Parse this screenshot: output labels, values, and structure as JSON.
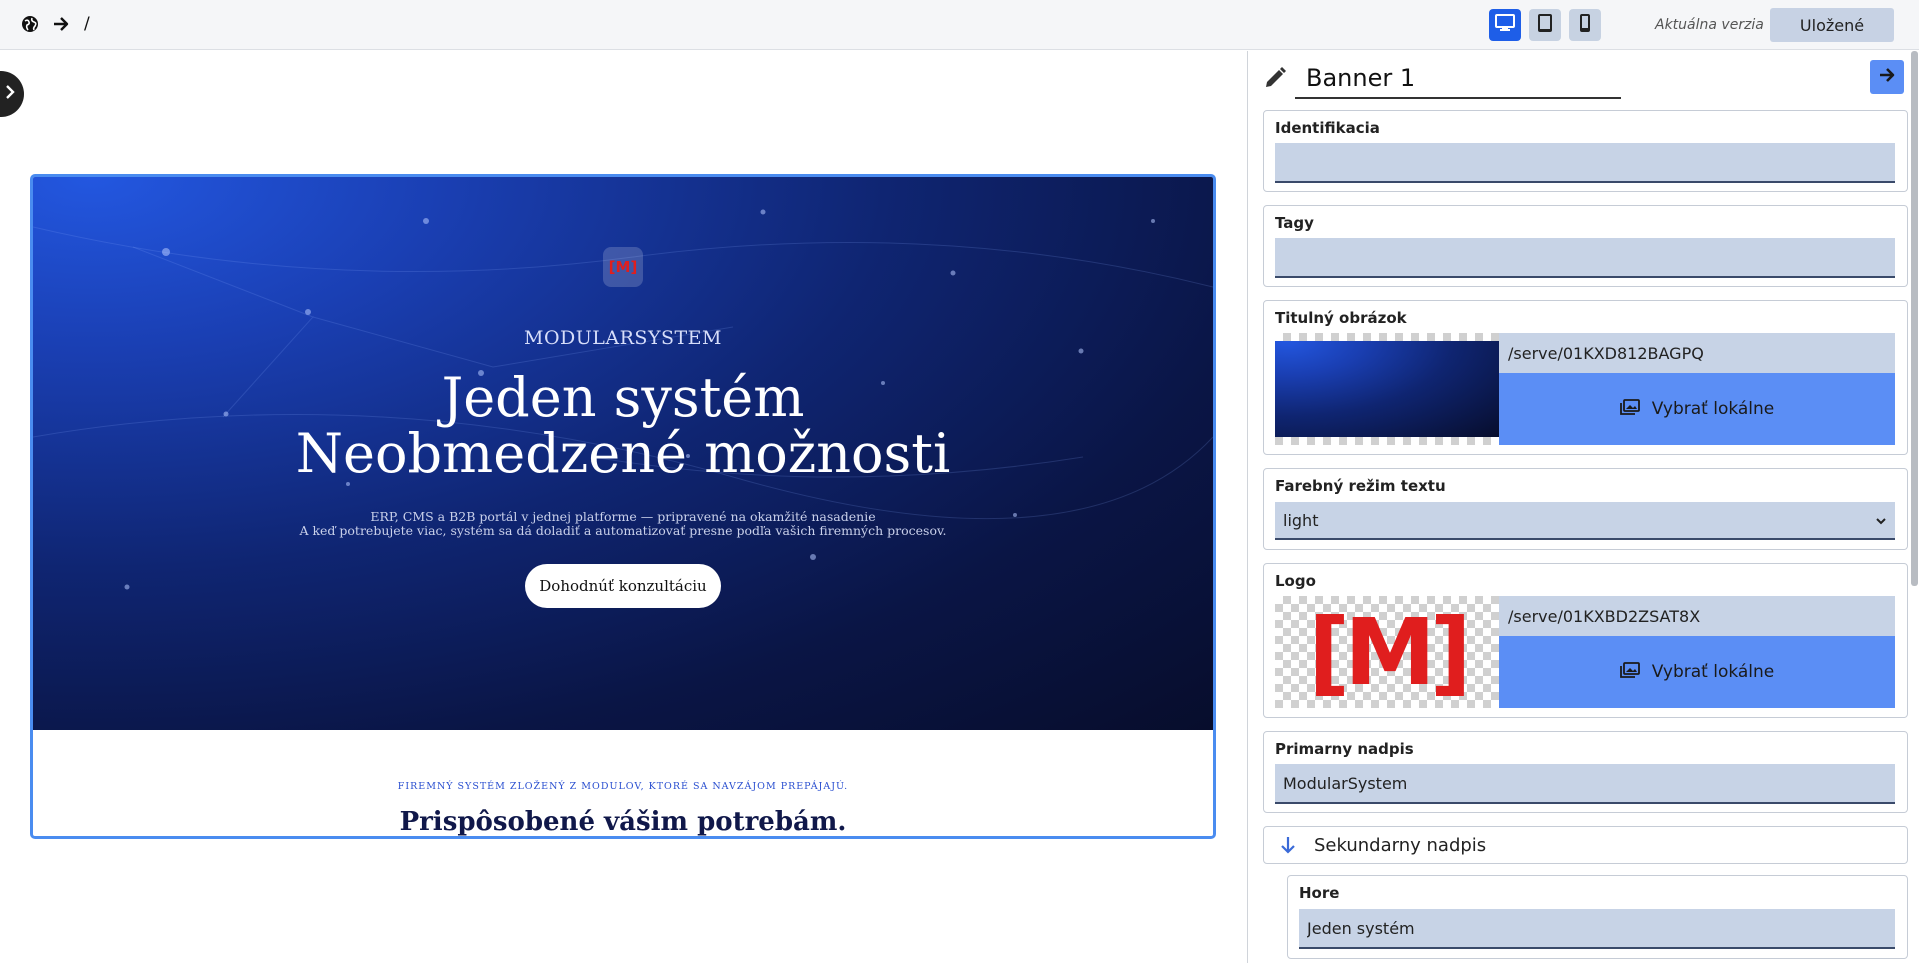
{
  "topbar": {
    "path": "/",
    "version_label": "Aktuálna verzia",
    "saved_label": "Uložené",
    "icons": [
      "globe-icon",
      "arrow-right-icon",
      "desktop-icon",
      "tablet-icon",
      "mobile-icon"
    ]
  },
  "preview": {
    "logo_text": "[M]",
    "brand": "MODULARSYSTEM",
    "title_line1": "Jeden systém",
    "title_line2": "Neobmedzené možnosti",
    "sub_line1": "ERP, CMS a B2B portál v jednej platforme — pripravené na okamžité nasadenie",
    "sub_line2": "A keď potrebujete viac, systém sa dá doladiť a automatizovať presne podľa vašich firemných procesov.",
    "cta_label": "Dohodnúť konzultáciu",
    "eyebrow": "FIREMNÝ SYSTÉM ZLOŽENÝ Z MODULOV, KTORÉ SA NAVZÁJOM PREPÁJAJÚ.",
    "section_title": "Prispôsobené vášim potrebám."
  },
  "panel": {
    "title_value": "Banner 1",
    "fields": {
      "identifikacia": {
        "label": "Identifikacia",
        "value": ""
      },
      "tagy": {
        "label": "Tagy",
        "value": ""
      },
      "titulny_obrazok": {
        "label": "Titulný obrázok",
        "path": "/serve/01KXD812BAGPQ",
        "pick_label": "Vybrať lokálne"
      },
      "farebny_rezim": {
        "label": "Farebný režim textu",
        "value": "light"
      },
      "logo": {
        "label": "Logo",
        "path": "/serve/01KXBD2ZSAT8X",
        "pick_label": "Vybrať lokálne",
        "logo_text": "[M]"
      },
      "primarny_nadpis": {
        "label": "Primarny nadpis",
        "value": "ModularSystem"
      },
      "sekundarny_nadpis": {
        "label": "Sekundarny nadpis"
      },
      "hore": {
        "label": "Hore",
        "value": "Jeden systém"
      }
    }
  },
  "colors": {
    "accent": "#1e5ee8",
    "button_blue": "#5b8ef5",
    "input_bg": "#c7d3e6",
    "logo_red": "#e01e1e"
  }
}
